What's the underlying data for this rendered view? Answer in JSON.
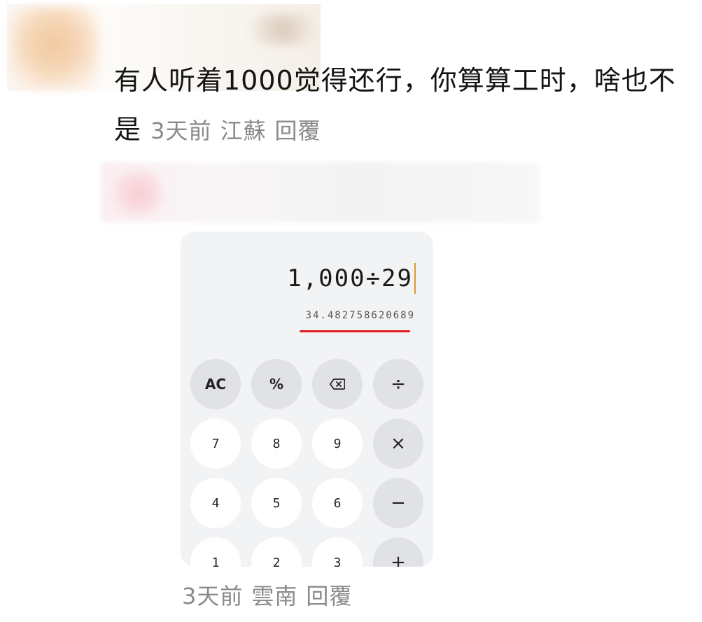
{
  "comment_1": {
    "text": "有人听着1000觉得还行，你算算工时，啥也不是",
    "time": "3天前",
    "location": "江蘇",
    "reply": "回覆"
  },
  "comment_2": {
    "time": "3天前",
    "location": "雲南",
    "reply": "回覆"
  },
  "calculator": {
    "expression": "1,000÷29",
    "result": "34.482758620689",
    "keys": {
      "ac": "AC",
      "percent": "%",
      "divide": "÷",
      "seven": "7",
      "eight": "8",
      "nine": "9",
      "multiply": "×",
      "four": "4",
      "five": "5",
      "six": "6",
      "minus": "−",
      "one": "1",
      "two": "2",
      "three": "3",
      "plus": "+"
    },
    "colors": {
      "background": "#f2f3f5",
      "function_key": "#e1e2e5",
      "number_key": "#ffffff",
      "caret": "#e39a23",
      "underline": "#e01e1e"
    },
    "icons": {
      "backspace": "backspace-icon"
    }
  }
}
